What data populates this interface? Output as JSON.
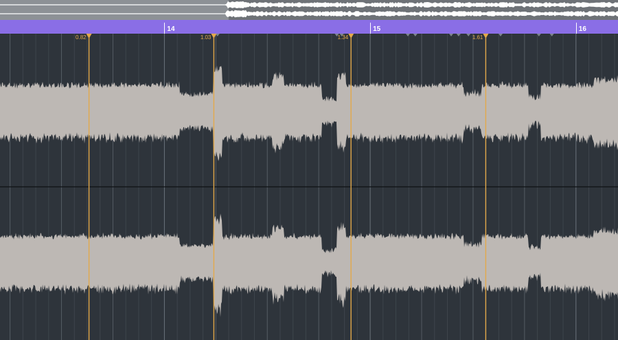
{
  "ruler": {
    "bars": [
      {
        "label": "14",
        "pos": 0.266
      },
      {
        "label": "15",
        "pos": 0.599
      },
      {
        "label": "16",
        "pos": 0.932
      }
    ]
  },
  "overview": {
    "visible_fraction": 0.37
  },
  "warp_markers": [
    {
      "label": "0.82",
      "pos": 0.144
    },
    {
      "label": "1.03",
      "pos": 0.346
    },
    {
      "label": "1.34",
      "pos": 0.568
    },
    {
      "label": "1.61",
      "pos": 0.786
    }
  ],
  "colors": {
    "ruler": "#8a6ee6",
    "waveform": "#bdb8b4",
    "marker": "#e3a94a",
    "grid": "#4a5158",
    "background": "#2e343b"
  }
}
